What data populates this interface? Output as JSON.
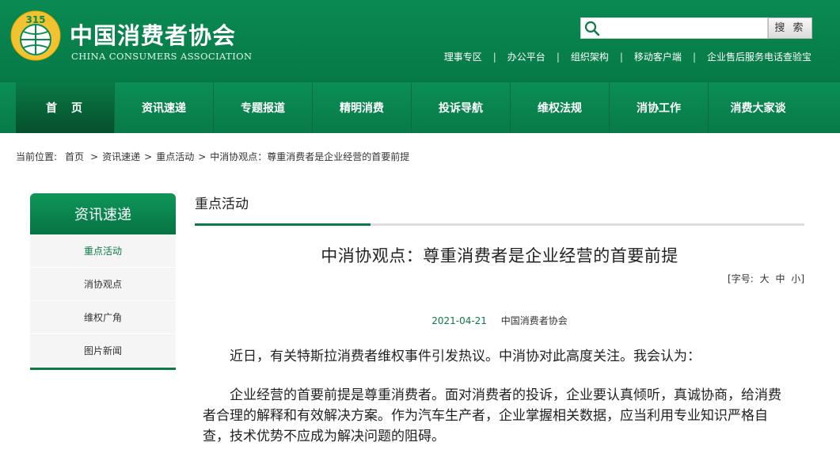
{
  "header": {
    "logo_cn": "中国消费者协会",
    "logo_en": "CHINA CONSUMERS ASSOCIATION",
    "emblem_text": "315",
    "search_placeholder": "",
    "search_button": "搜 索",
    "links": [
      "理事专区",
      "办公平台",
      "组织架构",
      "移动客户端",
      "企业售后服务电话查验宝"
    ],
    "brand_color": "#088a4f"
  },
  "nav": {
    "items": [
      "首　页",
      "资讯速递",
      "专题报道",
      "精明消费",
      "投诉导航",
      "维权法规",
      "消协工作",
      "消费大家谈"
    ]
  },
  "breadcrumb": {
    "label": "当前位置:",
    "items": [
      "首页",
      "资讯速递",
      "重点活动",
      "中消协观点：尊重消费者是企业经营的首要前提"
    ],
    "separator": ">"
  },
  "sidebar": {
    "title": "资讯速递",
    "items": [
      "重点活动",
      "消协观点",
      "维权广角",
      "图片新闻"
    ]
  },
  "main": {
    "section_title": "重点活动",
    "article_title": "中消协观点：尊重消费者是企业经营的首要前提",
    "fontsize_label": "[字号:",
    "fontsize_large": "大",
    "fontsize_medium": "中",
    "fontsize_small": "小",
    "fontsize_end": "]",
    "date": "2021-04-21",
    "source": "中国消费者协会",
    "paragraphs": [
      "近日，有关特斯拉消费者维权事件引发热议。中消协对此高度关注。我会认为：",
      "企业经营的首要前提是尊重消费者。面对消费者的投诉，企业要认真倾听，真诚协商，给消费者合理的解释和有效解决方案。作为汽车生产者，企业掌握相关数据，应当利用专业知识严格自查，技术优势不应成为解决问题的阻碍。"
    ]
  }
}
